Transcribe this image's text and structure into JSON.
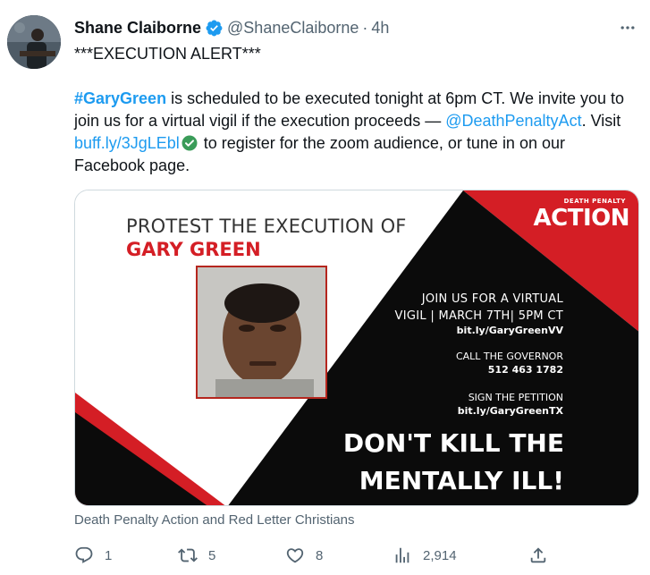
{
  "author": {
    "name": "Shane Claiborne",
    "handle": "@ShaneClaiborne",
    "separator": "·",
    "time": "4h",
    "verified_icon": "verified-badge-icon"
  },
  "more_icon": "more-options-icon",
  "tweet": {
    "line1": "***EXECUTION ALERT***",
    "hashtag": "#GaryGreen",
    "part1": " is scheduled to be executed tonight at 6pm CT. We invite you to join us for a virtual vigil if the execution proceeds — ",
    "mention": "@DeathPenaltyAct",
    "part2": ". Visit ",
    "link": "buff.ly/3JgLEbl",
    "part3": " to register for the zoom audience, or tune in on our Facebook page."
  },
  "poster": {
    "title_line1": "PROTEST THE EXECUTION OF",
    "title_line2": "GARY GREEN",
    "logo_small": "DEATH PENALTY",
    "logo_big": "ACTION",
    "vigil_line1": "JOIN US FOR A VIRTUAL",
    "vigil_line2": "VIGIL | MARCH 7TH| 5PM CT",
    "vigil_link": "bit.ly/GaryGreenVV",
    "call_label": "CALL THE GOVERNOR",
    "call_number": "512 463 1782",
    "petition_label": "SIGN THE PETITION",
    "petition_link": "bit.ly/GaryGreenTX",
    "slogan_line1": "DON'T KILL THE",
    "slogan_line2": "MENTALLY ILL!",
    "colors": {
      "red": "#d41e25",
      "black": "#0b0b0b"
    }
  },
  "caption": "Death Penalty Action and Red Letter Christians",
  "actions": {
    "replies": "1",
    "retweets": "5",
    "likes": "8",
    "views": "2,914"
  },
  "colors": {
    "accent": "#1d9bf0",
    "muted": "#536471"
  }
}
